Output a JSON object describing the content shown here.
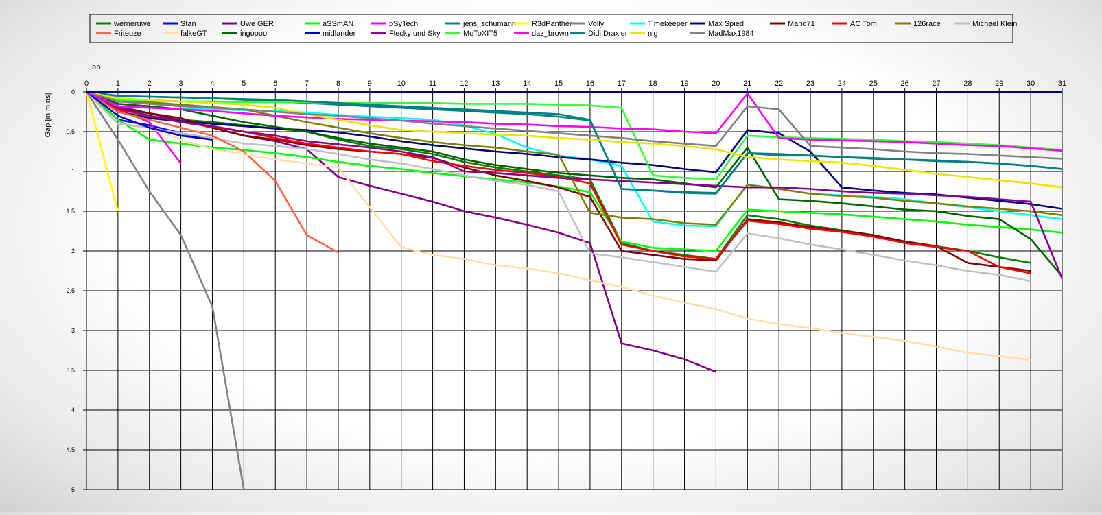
{
  "chart_data": {
    "type": "line",
    "xlabel": "Lap",
    "ylabel": "Gap [in mins]",
    "xlim": [
      0,
      31
    ],
    "ylim": [
      0,
      5
    ],
    "y_inverted": true,
    "grid": true,
    "legend_position": "top",
    "x_ticks": [
      "0",
      "1",
      "2",
      "3",
      "4",
      "5",
      "6",
      "7",
      "8",
      "9",
      "10",
      "11",
      "12",
      "13",
      "14",
      "15",
      "16",
      "17",
      "18",
      "19",
      "20",
      "21",
      "22",
      "23",
      "24",
      "25",
      "26",
      "27",
      "28",
      "29",
      "30",
      "31"
    ],
    "y_ticks": [
      "0",
      "0.5",
      "1",
      "1.5",
      "2",
      "2.5",
      "3",
      "3.5",
      "4",
      "4.5",
      "5"
    ],
    "leader_line": {
      "color": "#000080",
      "value": 0
    },
    "series": [
      {
        "name": "werneruwe",
        "color": "#008000",
        "values": [
          0,
          0.25,
          0.32,
          0.35,
          0.38,
          0.42,
          0.46,
          0.5,
          0.6,
          0.68,
          0.72,
          0.78,
          0.88,
          0.95,
          1.0,
          1.05,
          1.1,
          1.9,
          2.0,
          2.05,
          2.1,
          1.55,
          1.6,
          1.68,
          1.74,
          1.8,
          1.88,
          1.94,
          2.0,
          2.08,
          2.15
        ]
      },
      {
        "name": "Stan",
        "color": "#0000ff",
        "values": [
          0,
          0.35,
          0.42,
          0.52,
          0.6
        ]
      },
      {
        "name": "Uwe GER",
        "color": "#800080",
        "values": [
          0,
          0.18,
          0.27,
          0.36,
          0.45,
          0.55,
          0.62,
          0.72,
          1.07,
          1.18,
          1.28,
          1.38,
          1.5,
          1.58,
          1.67,
          1.77,
          1.9,
          3.16,
          3.25,
          3.36,
          3.52
        ]
      },
      {
        "name": "aSSmAN",
        "color": "#00ff00",
        "values": [
          0,
          0.35,
          0.6,
          0.65,
          0.7,
          0.73,
          0.77,
          0.82,
          0.88,
          0.93,
          0.97,
          1.02,
          1.06,
          1.1,
          1.14,
          1.19,
          1.26,
          1.88,
          1.96,
          1.98,
          2.0,
          1.48,
          1.5,
          1.52,
          1.54,
          1.57,
          1.6,
          1.63,
          1.67,
          1.7,
          1.73,
          1.77
        ]
      },
      {
        "name": "pSyTech",
        "color": "#ff00ff",
        "values": [
          0,
          0.22,
          0.38,
          0.9
        ]
      },
      {
        "name": "jens_schumann",
        "color": "#008080",
        "values": [
          0,
          0.05,
          0.06,
          0.07,
          0.08,
          0.1,
          0.12,
          0.14,
          0.16,
          0.18,
          0.2,
          0.22,
          0.24,
          0.26,
          0.28,
          0.31,
          0.36,
          1.22,
          1.24,
          1.27,
          1.28,
          0.77,
          0.8,
          0.8,
          0.82,
          0.83,
          0.85,
          0.86,
          0.88,
          0.9,
          0.93,
          0.97
        ]
      },
      {
        "name": "R3dPanther",
        "color": "#ffff00",
        "values": [
          0,
          1.5
        ]
      },
      {
        "name": "Volly",
        "color": "#808080",
        "values": [
          0,
          0.6,
          1.25,
          1.8,
          2.7,
          5.0
        ]
      },
      {
        "name": "Timekeeper",
        "color": "#00ffff",
        "values": [
          0,
          0.18,
          0.2,
          0.21,
          0.22,
          0.23,
          0.24,
          0.26,
          0.29,
          0.31,
          0.33,
          0.35,
          0.42,
          0.53,
          0.7,
          0.8,
          0.85,
          0.93,
          1.63,
          1.68,
          1.69,
          1.16,
          1.22,
          1.28,
          1.3,
          1.32,
          1.35,
          1.4,
          1.45,
          1.5,
          1.55,
          1.6
        ]
      },
      {
        "name": "Max Spied",
        "color": "#000080",
        "values": [
          0,
          0.25,
          0.33,
          0.37,
          0.4,
          0.43,
          0.46,
          0.48,
          0.51,
          0.56,
          0.62,
          0.67,
          0.71,
          0.75,
          0.78,
          0.82,
          0.85,
          0.89,
          0.92,
          0.97,
          1.01,
          0.48,
          0.52,
          0.75,
          1.2,
          1.24,
          1.27,
          1.29,
          1.33,
          1.37,
          1.41,
          1.47
        ]
      },
      {
        "name": "Mario71",
        "color": "#800000",
        "values": [
          0,
          0.2,
          0.27,
          0.33,
          0.45,
          0.55,
          0.6,
          0.67,
          0.72,
          0.75,
          0.78,
          0.83,
          0.95,
          1.05,
          1.12,
          1.2,
          1.32,
          2.0,
          2.05,
          2.1,
          2.12,
          1.6,
          1.64,
          1.7,
          1.75,
          1.8,
          1.88,
          1.94,
          2.15,
          2.2,
          2.25
        ]
      },
      {
        "name": "AC Tom",
        "color": "#ff0000",
        "values": [
          0,
          0.22,
          0.3,
          0.38,
          0.44,
          0.5,
          0.58,
          0.65,
          0.7,
          0.75,
          0.78,
          0.87,
          0.93,
          0.98,
          1.02,
          1.07,
          1.15,
          1.92,
          2.0,
          2.07,
          2.1,
          1.62,
          1.66,
          1.72,
          1.76,
          1.82,
          1.9,
          1.95,
          2.0,
          2.2,
          2.28
        ]
      },
      {
        "name": "126race",
        "color": "#808000",
        "values": [
          0,
          0.1,
          0.13,
          0.16,
          0.19,
          0.22,
          0.3,
          0.38,
          0.45,
          0.52,
          0.58,
          0.63,
          0.67,
          0.7,
          0.75,
          0.79,
          1.52,
          1.58,
          1.6,
          1.65,
          1.67,
          1.17,
          1.22,
          1.28,
          1.31,
          1.33,
          1.37,
          1.4,
          1.44,
          1.47,
          1.5,
          1.55
        ]
      },
      {
        "name": "Michael Klein",
        "color": "#c0c0c0",
        "values": [
          0,
          0.4,
          0.45,
          0.52,
          0.58,
          0.65,
          0.68,
          0.72,
          0.78,
          0.85,
          0.9,
          0.97,
          1.05,
          1.12,
          1.17,
          1.25,
          2.03,
          2.08,
          2.14,
          2.2,
          2.26,
          1.78,
          1.84,
          1.92,
          1.98,
          2.05,
          2.12,
          2.18,
          2.25,
          2.3,
          2.38
        ]
      },
      {
        "name": "Friteuze",
        "color": "#ff6347",
        "values": [
          0,
          0.25,
          0.35,
          0.45,
          0.55,
          0.75,
          1.12,
          1.8,
          2.02
        ]
      },
      {
        "name": "falkeGT",
        "color": "#ffdead",
        "values": [
          0,
          0.3,
          0.45,
          0.6,
          0.72,
          0.78,
          0.85,
          0.9,
          0.95,
          1.45,
          1.95,
          2.05,
          2.1,
          2.18,
          2.22,
          2.28,
          2.37,
          2.45,
          2.56,
          2.65,
          2.73,
          2.85,
          2.92,
          2.97,
          3.03,
          3.08,
          3.13,
          3.2,
          3.28,
          3.32,
          3.37
        ]
      },
      {
        "name": "ingoooo",
        "color": "#006400",
        "values": [
          0,
          0.15,
          0.18,
          0.22,
          0.3,
          0.38,
          0.44,
          0.5,
          0.58,
          0.65,
          0.7,
          0.75,
          0.85,
          0.92,
          0.97,
          1.02,
          1.05,
          1.08,
          1.1,
          1.15,
          1.2,
          0.7,
          1.35,
          1.37,
          1.4,
          1.44,
          1.48,
          1.5,
          1.56,
          1.6,
          1.85,
          2.32
        ]
      },
      {
        "name": "midlander",
        "color": "#0000cd",
        "values": [
          0,
          0.3,
          0.45,
          0.55,
          0.6
        ]
      },
      {
        "name": "Flecky und Sky",
        "color": "#8b008b",
        "values": [
          0,
          0.2,
          0.3,
          0.38,
          0.43,
          0.5,
          0.55,
          0.62,
          0.66,
          0.7,
          0.75,
          0.82,
          1.0,
          1.02,
          1.05,
          1.08,
          1.1,
          1.12,
          1.14,
          1.16,
          1.18,
          1.2,
          1.2,
          1.22,
          1.25,
          1.27,
          1.28,
          1.3,
          1.32,
          1.35,
          1.38,
          2.35
        ]
      },
      {
        "name": "MoToXIT5",
        "color": "#32ff32",
        "values": [
          0,
          0.1,
          0.11,
          0.12,
          0.12,
          0.13,
          0.13,
          0.13,
          0.14,
          0.14,
          0.14,
          0.14,
          0.15,
          0.15,
          0.15,
          0.16,
          0.17,
          0.2,
          1.05,
          1.08,
          1.1,
          0.55,
          0.57,
          0.58,
          0.59,
          0.6,
          0.62,
          0.63,
          0.65,
          0.67,
          0.7,
          0.73
        ]
      },
      {
        "name": "daz_brown",
        "color": "#ff00ff",
        "values": [
          0,
          0.18,
          0.2,
          0.22,
          0.24,
          0.27,
          0.3,
          0.32,
          0.34,
          0.35,
          0.36,
          0.37,
          0.38,
          0.4,
          0.41,
          0.43,
          0.44,
          0.46,
          0.47,
          0.5,
          0.52,
          0.02,
          0.58,
          0.6,
          0.61,
          0.62,
          0.63,
          0.65,
          0.67,
          0.68,
          0.71,
          0.74
        ]
      },
      {
        "name": "Didi Draxler",
        "color": "#008080",
        "values": [
          0,
          0.05,
          0.06,
          0.07,
          0.08,
          0.09,
          0.1,
          0.12,
          0.14,
          0.16,
          0.18,
          0.2,
          0.22,
          0.24,
          0.26,
          0.28,
          0.35,
          1.22,
          1.24,
          1.26,
          1.27,
          0.77,
          0.78,
          0.8,
          0.82,
          0.84,
          0.85,
          0.87,
          0.88,
          0.9,
          0.93,
          0.97
        ]
      },
      {
        "name": "nig",
        "color": "#e6e600",
        "values": [
          0,
          0.08,
          0.1,
          0.12,
          0.14,
          0.16,
          0.2,
          0.28,
          0.35,
          0.42,
          0.48,
          0.5,
          0.52,
          0.54,
          0.55,
          0.58,
          0.6,
          0.63,
          0.65,
          0.68,
          0.72,
          0.82,
          0.85,
          0.87,
          0.89,
          0.93,
          0.98,
          1.03,
          1.07,
          1.11,
          1.15,
          1.2
        ]
      },
      {
        "name": "MadMax1984",
        "color": "#808080",
        "values": [
          0,
          0.12,
          0.15,
          0.18,
          0.2,
          0.22,
          0.25,
          0.28,
          0.3,
          0.33,
          0.36,
          0.4,
          0.43,
          0.46,
          0.49,
          0.52,
          0.55,
          0.58,
          0.62,
          0.65,
          0.68,
          0.18,
          0.22,
          0.68,
          0.7,
          0.72,
          0.75,
          0.77,
          0.78,
          0.8,
          0.82,
          0.84
        ]
      }
    ]
  }
}
